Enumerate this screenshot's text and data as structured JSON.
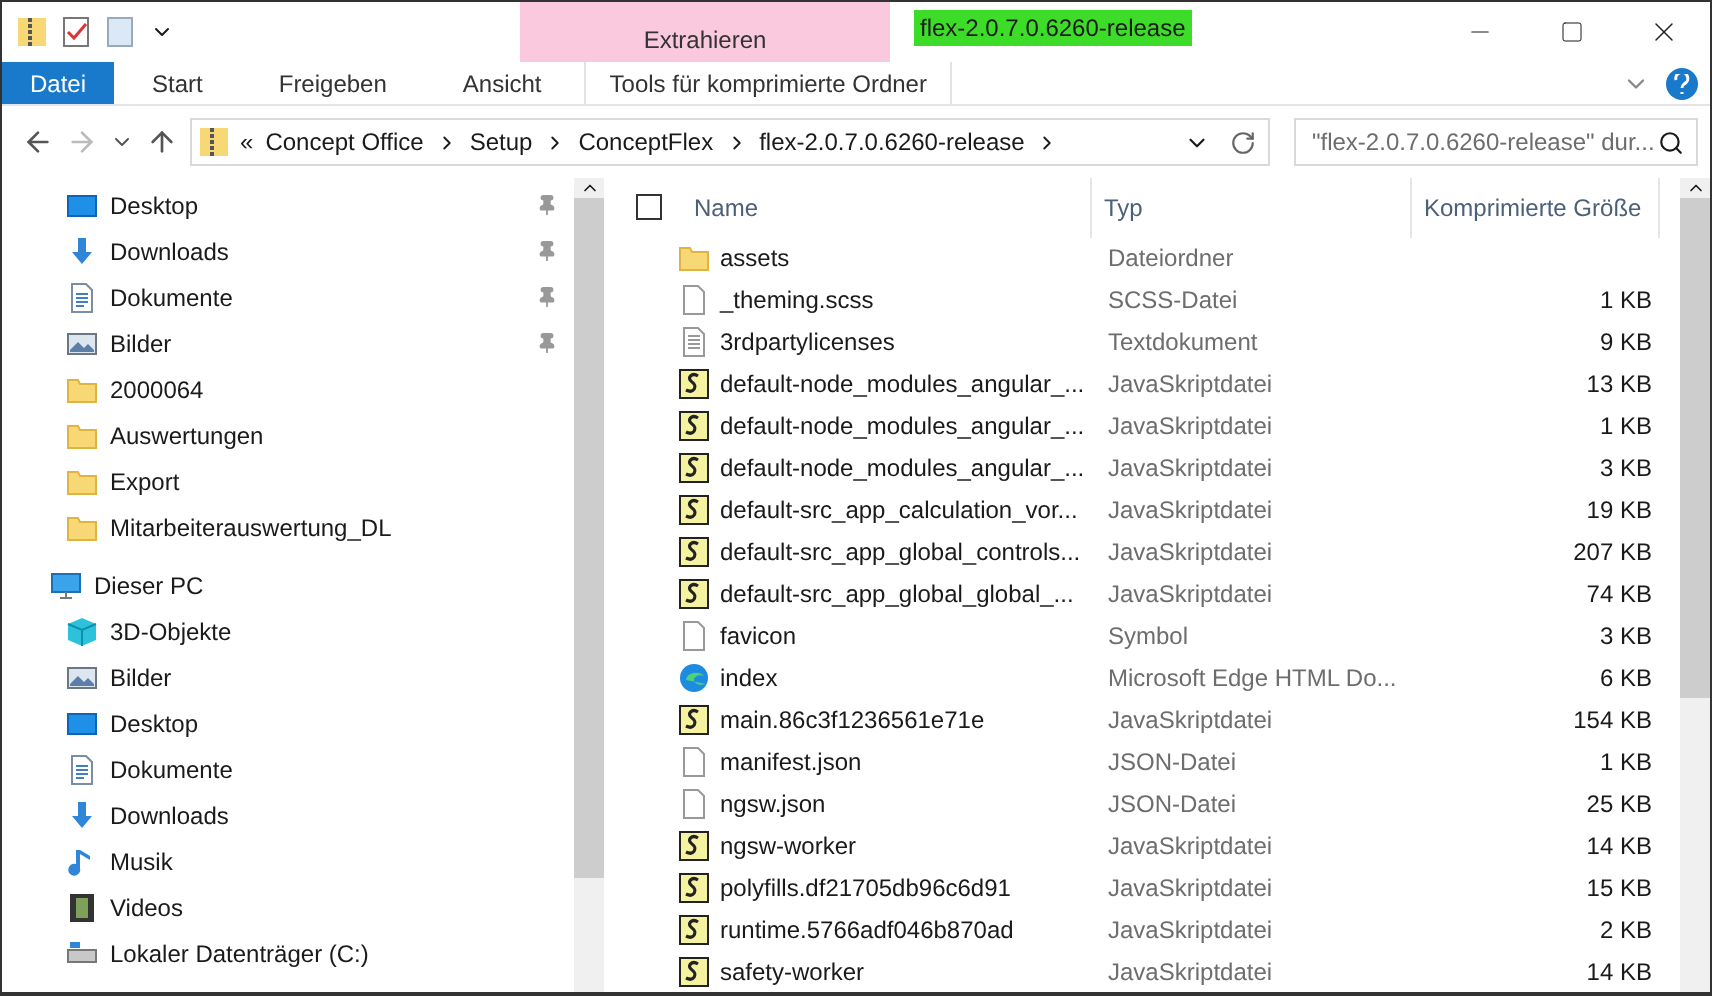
{
  "window": {
    "title": "flex-2.0.7.0.6260-release",
    "context_tab": "Extrahieren"
  },
  "ribbon_tabs": [
    {
      "label": "Datei",
      "selected": true,
      "kind": "file"
    },
    {
      "label": "Start",
      "selected": false,
      "kind": "normal"
    },
    {
      "label": "Freigeben",
      "selected": false,
      "kind": "normal"
    },
    {
      "label": "Ansicht",
      "selected": false,
      "kind": "normal"
    },
    {
      "label": "Tools für komprimierte Ordner",
      "selected": false,
      "kind": "context"
    }
  ],
  "address": {
    "prefix": "«",
    "crumbs": [
      "Concept Office",
      "Setup",
      "ConceptFlex",
      "flex-2.0.7.0.6260-release"
    ]
  },
  "search": {
    "placeholder": "\"flex-2.0.7.0.6260-release\" dur..."
  },
  "sidebar": {
    "quick_access": [
      {
        "label": "Desktop",
        "kind": "desktop",
        "pinned": true
      },
      {
        "label": "Downloads",
        "kind": "download",
        "pinned": true
      },
      {
        "label": "Dokumente",
        "kind": "document",
        "pinned": true
      },
      {
        "label": "Bilder",
        "kind": "image",
        "pinned": true
      },
      {
        "label": "2000064",
        "kind": "folder",
        "pinned": false
      },
      {
        "label": "Auswertungen",
        "kind": "folder",
        "pinned": false
      },
      {
        "label": "Export",
        "kind": "folder",
        "pinned": false
      },
      {
        "label": "Mitarbeiterauswertung_DL",
        "kind": "folder",
        "pinned": false
      }
    ],
    "this_pc": {
      "label": "Dieser PC",
      "children": [
        {
          "label": "3D-Objekte",
          "kind": "cube"
        },
        {
          "label": "Bilder",
          "kind": "image"
        },
        {
          "label": "Desktop",
          "kind": "desktop"
        },
        {
          "label": "Dokumente",
          "kind": "document"
        },
        {
          "label": "Downloads",
          "kind": "download"
        },
        {
          "label": "Musik",
          "kind": "music"
        },
        {
          "label": "Videos",
          "kind": "video"
        },
        {
          "label": "Lokaler Datenträger (C:)",
          "kind": "drive"
        }
      ]
    }
  },
  "table": {
    "columns": [
      "Name",
      "Typ",
      "Komprimierte Größe"
    ],
    "select_all": {
      "checked": false
    },
    "rows": [
      {
        "name": "assets",
        "type": "Dateiordner",
        "size": "",
        "kind": "folder"
      },
      {
        "name": "_theming.scss",
        "type": "SCSS-Datei",
        "size": "1 KB",
        "kind": "file"
      },
      {
        "name": "3rdpartylicenses",
        "type": "Textdokument",
        "size": "9 KB",
        "kind": "text"
      },
      {
        "name": "default-node_modules_angular_...",
        "type": "JavaSkriptdatei",
        "size": "13 KB",
        "kind": "script"
      },
      {
        "name": "default-node_modules_angular_...",
        "type": "JavaSkriptdatei",
        "size": "1 KB",
        "kind": "script"
      },
      {
        "name": "default-node_modules_angular_...",
        "type": "JavaSkriptdatei",
        "size": "3 KB",
        "kind": "script"
      },
      {
        "name": "default-src_app_calculation_vor...",
        "type": "JavaSkriptdatei",
        "size": "19 KB",
        "kind": "script"
      },
      {
        "name": "default-src_app_global_controls...",
        "type": "JavaSkriptdatei",
        "size": "207 KB",
        "kind": "script"
      },
      {
        "name": "default-src_app_global_global_...",
        "type": "JavaSkriptdatei",
        "size": "74 KB",
        "kind": "script"
      },
      {
        "name": "favicon",
        "type": "Symbol",
        "size": "3 KB",
        "kind": "file"
      },
      {
        "name": "index",
        "type": "Microsoft Edge HTML Do...",
        "size": "6 KB",
        "kind": "browser"
      },
      {
        "name": "main.86c3f1236561e71e",
        "type": "JavaSkriptdatei",
        "size": "154 KB",
        "kind": "script"
      },
      {
        "name": "manifest.json",
        "type": "JSON-Datei",
        "size": "1 KB",
        "kind": "file"
      },
      {
        "name": "ngsw.json",
        "type": "JSON-Datei",
        "size": "25 KB",
        "kind": "file"
      },
      {
        "name": "ngsw-worker",
        "type": "JavaSkriptdatei",
        "size": "14 KB",
        "kind": "script"
      },
      {
        "name": "polyfills.df21705db96c6d91",
        "type": "JavaSkriptdatei",
        "size": "15 KB",
        "kind": "script"
      },
      {
        "name": "runtime.5766adf046b870ad",
        "type": "JavaSkriptdatei",
        "size": "2 KB",
        "kind": "script"
      },
      {
        "name": "safety-worker",
        "type": "JavaSkriptdatei",
        "size": "14 KB",
        "kind": "script"
      }
    ]
  }
}
